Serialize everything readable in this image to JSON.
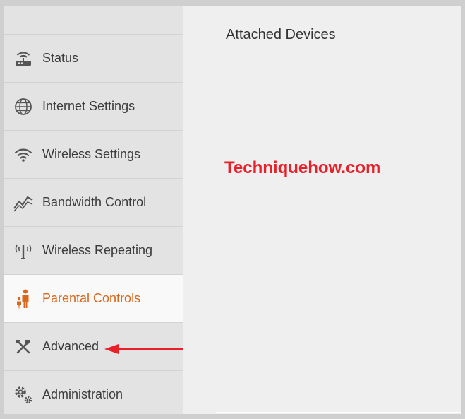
{
  "header": {
    "title": "Attached Devices"
  },
  "watermark": "Techniquehow.com",
  "accent_color": "#d9661a",
  "annotation_arrow_color": "#e8202a",
  "sidebar": {
    "items": [
      {
        "label": "Status",
        "icon": "router-icon"
      },
      {
        "label": "Internet Settings",
        "icon": "globe-icon"
      },
      {
        "label": "Wireless Settings",
        "icon": "wifi-icon"
      },
      {
        "label": "Bandwidth Control",
        "icon": "bandwidth-chart-icon"
      },
      {
        "label": "Wireless Repeating",
        "icon": "antenna-icon"
      },
      {
        "label": "Parental Controls",
        "icon": "family-icon",
        "active": true
      },
      {
        "label": "Advanced",
        "icon": "tools-icon"
      },
      {
        "label": "Administration",
        "icon": "gears-icon"
      }
    ]
  }
}
